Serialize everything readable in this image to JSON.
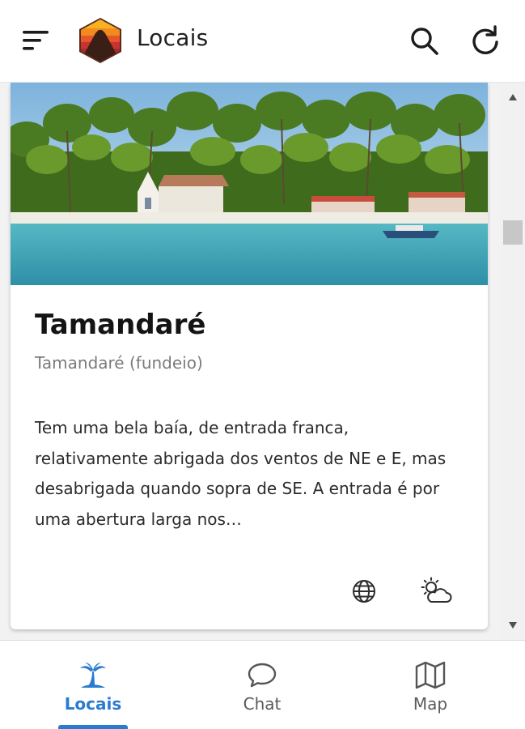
{
  "header": {
    "title": "Locais",
    "menu_icon": "menu-icon",
    "logo_icon": "volcano-logo",
    "search_icon": "search-icon",
    "refresh_icon": "refresh-icon"
  },
  "card": {
    "title": "Tamandaré",
    "subtitle": "Tamandaré (fundeio)",
    "description": "Tem uma bela baía, de entrada franca, relativamente abrigada dos ventos de NE e E, mas desabrigada quando sopra de SE. A entrada é por uma abertura larga nos…",
    "actions": [
      {
        "name": "globe-icon"
      },
      {
        "name": "weather-icon"
      }
    ]
  },
  "bottom_nav": {
    "items": [
      {
        "label": "Locais",
        "icon": "island-icon",
        "active": true
      },
      {
        "label": "Chat",
        "icon": "chat-icon",
        "active": false
      },
      {
        "label": "Map",
        "icon": "map-icon",
        "active": false
      }
    ]
  },
  "colors": {
    "accent": "#2a7bd0",
    "subtitle": "#7b7b7b"
  }
}
